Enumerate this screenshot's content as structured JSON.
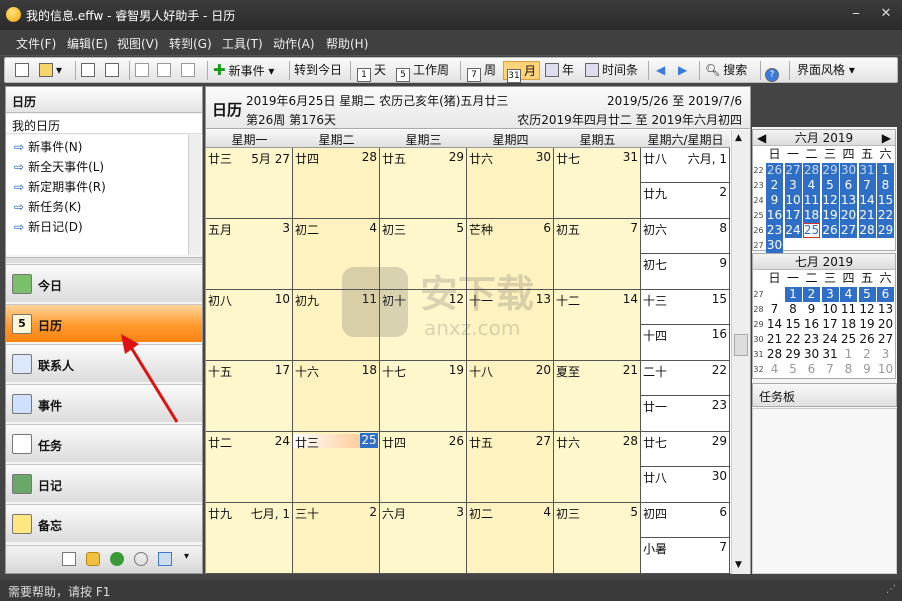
{
  "window": {
    "title": "我的信息.effw - 睿智男人好助手 - 日历",
    "minimize": "⎯",
    "close": "✕"
  },
  "menu": [
    "文件(F)",
    "编辑(E)",
    "视图(V)",
    "转到(G)",
    "工具(T)",
    "动作(A)",
    "帮助(H)"
  ],
  "toolbar": {
    "new_event": "新事件",
    "goto_today": "转到今日",
    "day": "天",
    "workweek": "工作周",
    "week": "周",
    "month": "月",
    "year": "年",
    "timeline": "时间条",
    "search": "搜索",
    "theme": "界面风格",
    "day_icon": "1",
    "workweek_icon": "5",
    "week_icon": "7",
    "month_icon": "31"
  },
  "left": {
    "header": "日历",
    "subheader": "我的日历",
    "actions": [
      "新事件(N)",
      "新全天事件(L)",
      "新定期事件(R)",
      "新任务(K)",
      "新日记(D)"
    ],
    "nav": [
      "今日",
      "日历",
      "联系人",
      "事件",
      "任务",
      "日记",
      "备忘"
    ],
    "selected_nav": "日历"
  },
  "calendar": {
    "title": "日历",
    "date_line": "2019年6月25日  星期二  农历己亥年(猪)五月廿三",
    "week_line": "第26周 第176天",
    "range": "2019/5/26 至 2019/7/6",
    "lunar_range": "农历2019年四月廿二 至 2019年六月初四",
    "weekdays": [
      "星期一",
      "星期二",
      "星期三",
      "星期四",
      "星期五",
      "星期六/星期日"
    ],
    "weeks": [
      {
        "days": [
          [
            "廿三",
            "5月 27"
          ],
          [
            "廿四",
            "28"
          ],
          [
            "廿五",
            "29"
          ],
          [
            "廿六",
            "30"
          ],
          [
            "廿七",
            "31"
          ]
        ],
        "sat": [
          "廿八",
          "六月, 1"
        ],
        "sun": [
          "廿九",
          "2"
        ]
      },
      {
        "days": [
          [
            "五月",
            "3"
          ],
          [
            "初二",
            "4"
          ],
          [
            "初三",
            "5"
          ],
          [
            "芒种",
            "6"
          ],
          [
            "初五",
            "7"
          ]
        ],
        "sat": [
          "初六",
          "8"
        ],
        "sun": [
          "初七",
          "9"
        ]
      },
      {
        "days": [
          [
            "初八",
            "10"
          ],
          [
            "初九",
            "11"
          ],
          [
            "初十",
            "12"
          ],
          [
            "十一",
            "13"
          ],
          [
            "十二",
            "14"
          ]
        ],
        "sat": [
          "十三",
          "15"
        ],
        "sun": [
          "十四",
          "16"
        ]
      },
      {
        "days": [
          [
            "十五",
            "17"
          ],
          [
            "十六",
            "18"
          ],
          [
            "十七",
            "19"
          ],
          [
            "十八",
            "20"
          ],
          [
            "夏至",
            "21"
          ]
        ],
        "sat": [
          "二十",
          "22"
        ],
        "sun": [
          "廿一",
          "23"
        ]
      },
      {
        "days": [
          [
            "廿二",
            "24"
          ],
          [
            "廿三",
            "25"
          ],
          [
            "廿四",
            "26"
          ],
          [
            "廿五",
            "27"
          ],
          [
            "廿六",
            "28"
          ]
        ],
        "sat": [
          "廿七",
          "29"
        ],
        "sun": [
          "廿八",
          "30"
        ]
      },
      {
        "days": [
          [
            "廿九",
            "七月, 1"
          ],
          [
            "三十",
            "2"
          ],
          [
            "六月",
            "3"
          ],
          [
            "初二",
            "4"
          ],
          [
            "初三",
            "5"
          ]
        ],
        "sat": [
          "初四",
          "6"
        ],
        "sun": [
          "小暑",
          "7"
        ]
      }
    ],
    "today_week": 4,
    "today_day": 1
  },
  "mini": {
    "june_title": "六月 2019",
    "july_title": "七月 2019",
    "dow": [
      "日",
      "一",
      "二",
      "三",
      "四",
      "五",
      "六"
    ],
    "june_weeks": [
      "22",
      "23",
      "24",
      "25",
      "26",
      "27"
    ],
    "june_rows": [
      [
        "26",
        "27",
        "28",
        "29",
        "30",
        "31",
        "1"
      ],
      [
        "2",
        "3",
        "4",
        "5",
        "6",
        "7",
        "8"
      ],
      [
        "9",
        "10",
        "11",
        "12",
        "13",
        "14",
        "15"
      ],
      [
        "16",
        "17",
        "18",
        "19",
        "20",
        "21",
        "22"
      ],
      [
        "23",
        "24",
        "25",
        "26",
        "27",
        "28",
        "29"
      ],
      [
        "30",
        "",
        "",
        "",
        "",
        "",
        ""
      ]
    ],
    "july_weeks": [
      "27",
      "28",
      "29",
      "30",
      "31",
      "32"
    ],
    "july_rows": [
      [
        "",
        "1",
        "2",
        "3",
        "4",
        "5",
        "6"
      ],
      [
        "7",
        "8",
        "9",
        "10",
        "11",
        "12",
        "13"
      ],
      [
        "14",
        "15",
        "16",
        "17",
        "18",
        "19",
        "20"
      ],
      [
        "21",
        "22",
        "23",
        "24",
        "25",
        "26",
        "27"
      ],
      [
        "28",
        "29",
        "30",
        "31",
        "1",
        "2",
        "3"
      ],
      [
        "4",
        "5",
        "6",
        "7",
        "8",
        "9",
        "10"
      ]
    ],
    "prev": "◀",
    "next": "▶"
  },
  "taskpane": "任务板",
  "status": "需要帮助，请按 F1",
  "watermark": {
    "main": "安下载",
    "sub": "anxz.com"
  },
  "colors": {
    "selection_blue": "#2f6fc7",
    "cell_bg": "#fff7cc",
    "nav_selected": "#ff9a2e"
  }
}
